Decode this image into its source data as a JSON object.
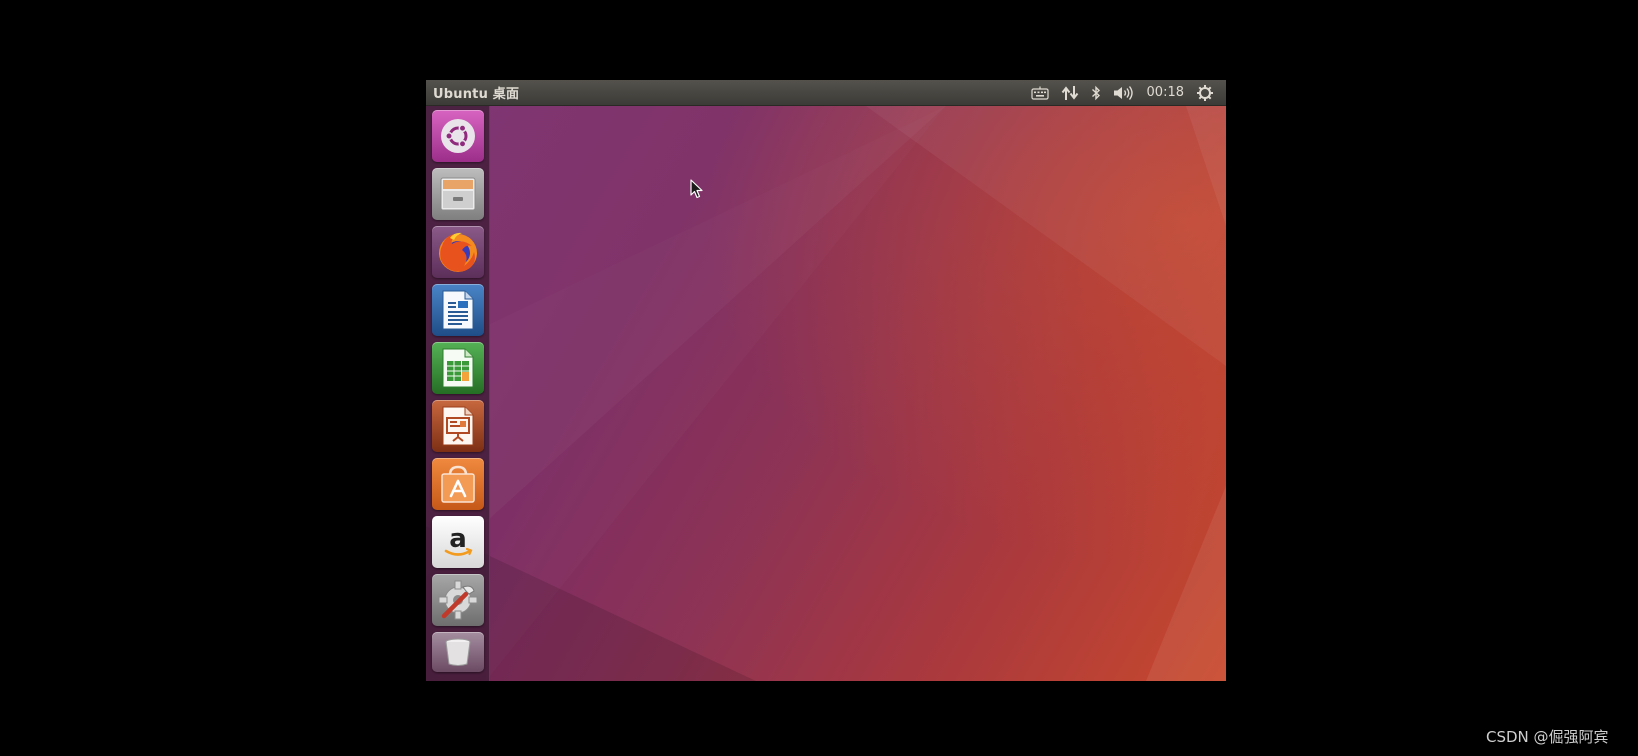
{
  "panel": {
    "title": "Ubuntu 桌面",
    "clock": "00:18",
    "indicators": [
      "keyboard-icon",
      "network-icon",
      "bluetooth-icon",
      "volume-icon",
      "system-menu-icon"
    ]
  },
  "launcher": {
    "items": [
      {
        "name": "dash-home",
        "icon": "ubuntu-logo-icon",
        "color": "#c24dab"
      },
      {
        "name": "files",
        "icon": "file-cabinet-icon",
        "color": "#9a9a9a"
      },
      {
        "name": "firefox",
        "icon": "firefox-icon",
        "color": "#e66000"
      },
      {
        "name": "libreoffice-writer",
        "icon": "writer-document-icon",
        "color": "#2a6fbd"
      },
      {
        "name": "libreoffice-calc",
        "icon": "calc-spreadsheet-icon",
        "color": "#3a9a3a"
      },
      {
        "name": "libreoffice-impress",
        "icon": "impress-presentation-icon",
        "color": "#b14a22"
      },
      {
        "name": "ubuntu-software",
        "icon": "shopping-bag-icon",
        "color": "#ee7a2f"
      },
      {
        "name": "amazon",
        "icon": "amazon-icon",
        "color": "#f3f3f3"
      },
      {
        "name": "system-settings",
        "icon": "settings-gear-wrench-icon",
        "color": "#8a8a8a"
      },
      {
        "name": "trash",
        "icon": "trash-icon",
        "color": "#9c8896"
      }
    ]
  },
  "watermark": "CSDN @倔强阿宾"
}
